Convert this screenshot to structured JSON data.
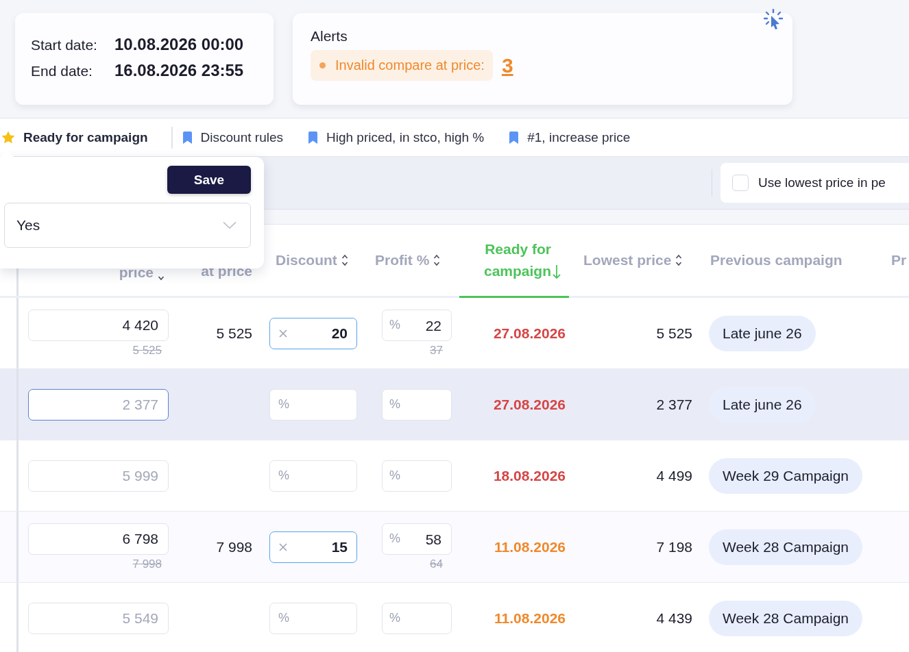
{
  "period": {
    "start_label": "Start date:",
    "start": "10.08.2026 00:00",
    "end_label": "End date:",
    "end": "16.08.2026 23:55"
  },
  "alerts": {
    "title": "Alerts",
    "items": [
      {
        "label": "Invalid compare at price:",
        "count": "3"
      }
    ]
  },
  "tabs": [
    {
      "kind": "star",
      "label": "Ready for campaign",
      "selected": true
    },
    {
      "kind": "bookmark",
      "label": "Discount rules",
      "selected": false
    },
    {
      "kind": "bookmark",
      "label": "High priced, in stco, high %",
      "selected": false
    },
    {
      "kind": "bookmark",
      "label": "#1, increase price",
      "selected": false
    }
  ],
  "popover": {
    "button": "Save",
    "select": {
      "value": "Yes"
    }
  },
  "toolbar": {
    "checkbox": {
      "label": "Use lowest price in pe",
      "checked": false
    }
  },
  "table": {
    "columns": [
      {
        "label": "price",
        "kind": "dropdown",
        "active": false
      },
      {
        "label": "at price",
        "kind": "plain",
        "active": false
      },
      {
        "label": "Discount",
        "kind": "sortable",
        "active": false
      },
      {
        "label": "Profit %",
        "kind": "sortable",
        "active": false
      },
      {
        "label": "Ready for campaign",
        "kind": "sorted",
        "active": true
      },
      {
        "label": "Lowest price",
        "kind": "sortable",
        "active": false
      },
      {
        "label": "Previous campaign",
        "kind": "plain",
        "active": false
      },
      {
        "label": "Pr",
        "kind": "plain",
        "active": false
      }
    ],
    "rows": [
      {
        "selected": false,
        "price": {
          "value": "4 420",
          "old": "5 525",
          "focused": false
        },
        "compare": "5 525",
        "discount": {
          "value": "20",
          "focused": true
        },
        "profit": {
          "prefix": "%",
          "value": "22",
          "old": "37"
        },
        "ready": "27.08.2026",
        "color": "#d64545",
        "lowest": "5 525",
        "campaign": "Late june 26"
      },
      {
        "selected": true,
        "price": {
          "placeholder": "2 377",
          "focused": true
        },
        "discount": {
          "prefix": "%",
          "focused": false
        },
        "profit": {
          "prefix": "%"
        },
        "ready": "27.08.2026",
        "color": "#d64545",
        "lowest": "2 377",
        "campaign": "Late june 26"
      },
      {
        "selected": false,
        "price": {
          "placeholder": "5 999",
          "focused": false
        },
        "discount": {
          "prefix": "%",
          "focused": false
        },
        "profit": {
          "prefix": "%"
        },
        "ready": "18.08.2026",
        "color": "#d64545",
        "lowest": "4 499",
        "campaign": "Week 29 Campaign"
      },
      {
        "selected": false,
        "price": {
          "value": "6 798",
          "old": "7 998",
          "focused": false
        },
        "compare": "7 998",
        "discount": {
          "value": "15",
          "focused": true
        },
        "profit": {
          "prefix": "%",
          "value": "58",
          "old": "64"
        },
        "ready": "11.08.2026",
        "color": "#f0892b",
        "lowest": "7 198",
        "campaign": "Week 28 Campaign"
      },
      {
        "selected": false,
        "price": {
          "placeholder": "5 549",
          "focused": false
        },
        "discount": {
          "prefix": "%",
          "focused": false
        },
        "profit": {
          "prefix": "%"
        },
        "ready": "11.08.2026",
        "color": "#f0892b",
        "lowest": "4 439",
        "campaign": "Week 28 Campaign"
      }
    ]
  }
}
